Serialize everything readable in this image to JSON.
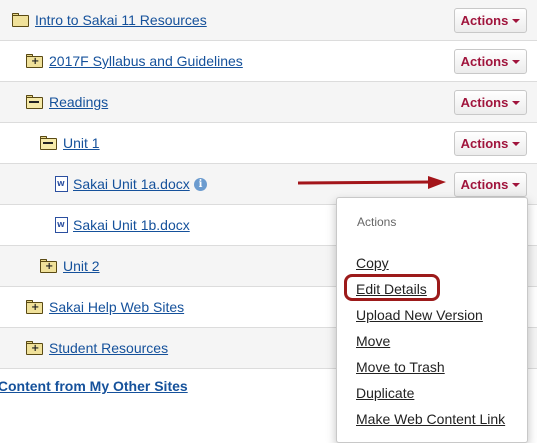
{
  "resources": [
    {
      "label": "Intro to Sakai 11 Resources",
      "kind": "folder-open",
      "actions": "Actions"
    },
    {
      "label": "2017F Syllabus and Guidelines",
      "kind": "folder-plus",
      "actions": "Actions"
    },
    {
      "label": "Readings",
      "kind": "folder-minus",
      "actions": "Actions"
    },
    {
      "label": "Unit 1",
      "kind": "folder-minus",
      "actions": "Actions"
    },
    {
      "label": "Sakai Unit 1a.docx",
      "kind": "doc",
      "actions": "Actions"
    },
    {
      "label": "Sakai Unit 1b.docx",
      "kind": "doc"
    },
    {
      "label": "Unit 2",
      "kind": "folder-plus"
    },
    {
      "label": "Sakai Help Web Sites",
      "kind": "folder-plus"
    },
    {
      "label": "Student Resources",
      "kind": "folder-plus"
    }
  ],
  "bottom_link": "Content from My Other Sites",
  "doc_icon_letter": "W",
  "info_icon_glyph": "i",
  "actions_menu": {
    "header": "Actions",
    "items": [
      "Copy",
      "Edit Details",
      "Upload New Version",
      "Move",
      "Move to Trash",
      "Duplicate",
      "Make Web Content Link"
    ],
    "highlighted_item": "Edit Details"
  },
  "colors": {
    "link": "#15519b",
    "actions_text": "#a0143c",
    "arrow": "#a3151a",
    "highlight_outline": "#9c1a1a"
  }
}
